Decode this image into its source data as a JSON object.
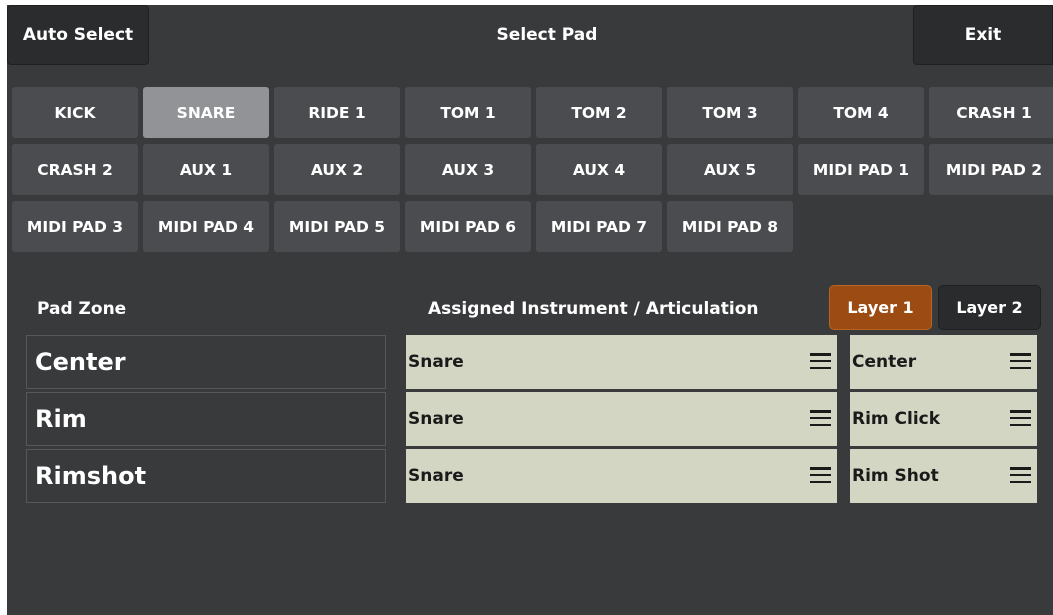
{
  "header": {
    "auto_select_label": "Auto Select",
    "title": "Select Pad",
    "exit_label": "Exit"
  },
  "pads": [
    {
      "label": "KICK",
      "selected": false
    },
    {
      "label": "SNARE",
      "selected": true
    },
    {
      "label": "RIDE 1",
      "selected": false
    },
    {
      "label": "TOM 1",
      "selected": false
    },
    {
      "label": "TOM 2",
      "selected": false
    },
    {
      "label": "TOM 3",
      "selected": false
    },
    {
      "label": "TOM 4",
      "selected": false
    },
    {
      "label": "CRASH 1",
      "selected": false
    },
    {
      "label": "CRASH 2",
      "selected": false
    },
    {
      "label": "AUX 1",
      "selected": false
    },
    {
      "label": "AUX 2",
      "selected": false
    },
    {
      "label": "AUX 3",
      "selected": false
    },
    {
      "label": "AUX 4",
      "selected": false
    },
    {
      "label": "AUX 5",
      "selected": false
    },
    {
      "label": "MIDI PAD 1",
      "selected": false
    },
    {
      "label": "MIDI PAD 2",
      "selected": false
    },
    {
      "label": "MIDI PAD 3",
      "selected": false
    },
    {
      "label": "MIDI PAD 4",
      "selected": false
    },
    {
      "label": "MIDI PAD 5",
      "selected": false
    },
    {
      "label": "MIDI PAD 6",
      "selected": false
    },
    {
      "label": "MIDI PAD 7",
      "selected": false
    },
    {
      "label": "MIDI PAD 8",
      "selected": false
    }
  ],
  "zones_section": {
    "pad_zone_label": "Pad Zone",
    "assigned_label": "Assigned Instrument / Articulation",
    "layers": [
      {
        "label": "Layer 1",
        "active": true
      },
      {
        "label": "Layer 2",
        "active": false
      }
    ],
    "rows": [
      {
        "zone": "Center",
        "instrument": "Snare",
        "articulation": "Center"
      },
      {
        "zone": "Rim",
        "instrument": "Snare",
        "articulation": "Rim Click"
      },
      {
        "zone": "Rimshot",
        "instrument": "Snare",
        "articulation": "Rim Shot"
      }
    ]
  },
  "icons": {
    "menu": "hamburger-menu-icon"
  },
  "colors": {
    "background": "#393a3c",
    "pad": "#4b4c4f",
    "pad_selected": "#919396",
    "layer_active": "#9c4c12",
    "assign_cell": "#d4d6c4"
  }
}
